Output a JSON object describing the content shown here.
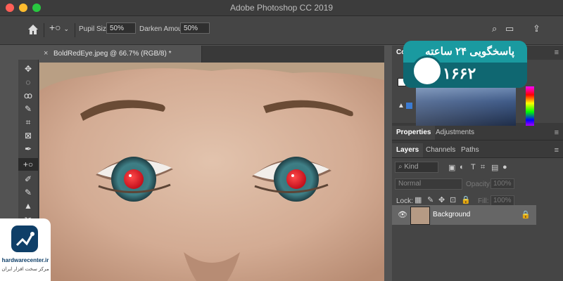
{
  "window": {
    "title": "Adobe Photoshop CC 2019",
    "traffic_lights": [
      "#ff5f57",
      "#febc2e",
      "#28c840"
    ]
  },
  "options_bar": {
    "pupil_size_label": "Pupil Size:",
    "pupil_size_value": "50%",
    "darken_amount_label": "Darken Amount:",
    "darken_amount_value": "50%"
  },
  "document_tab": {
    "close": "×",
    "title": "BoldRedEye.jpeg @ 66.7% (RGB/8) *"
  },
  "tools": [
    "✥",
    "◌",
    "ꝏ",
    "✎",
    "⌗",
    "⊠",
    "✒",
    "+○",
    "✐",
    "✎",
    "▲",
    "✂"
  ],
  "panels": {
    "color_tab": "Color",
    "properties_tab": "Properties",
    "adjustments_tab": "Adjustments",
    "layers_tab": "Layers",
    "channels_tab": "Channels",
    "paths_tab": "Paths",
    "filter_kind": "Kind",
    "blend_mode": "Normal",
    "opacity_label": "Opacity:",
    "opacity_value": "100%",
    "lock_label": "Lock:",
    "fill_label": "Fill:",
    "fill_value": "100%",
    "layer_name": "Background"
  },
  "badge": {
    "line1": "پاسخگویی ۲۴ ساعته",
    "phone": "۱۶۶۲"
  },
  "logo": {
    "brand": "hardwarecenter.ir",
    "tagline": "مرکز سخت افزار ایران"
  }
}
